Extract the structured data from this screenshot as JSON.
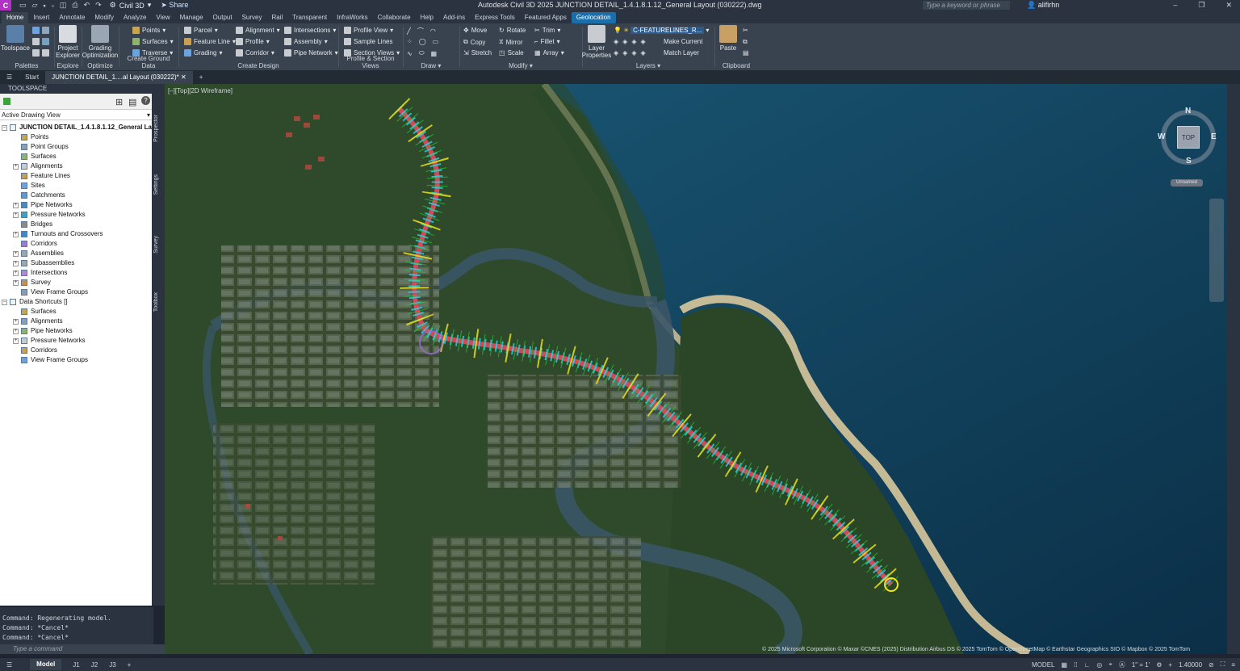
{
  "titlebar": {
    "app_letter": "C",
    "workspace": "Civil 3D",
    "share": "Share",
    "title": "Autodesk Civil 3D 2025   JUNCTION DETAIL_1.4.1.8.1.12_General Layout (030222).dwg",
    "search_placeholder": "Type a keyword or phrase",
    "user": "alifirhn"
  },
  "ribbon_tabs": [
    "Home",
    "Insert",
    "Annotate",
    "Modify",
    "Analyze",
    "View",
    "Manage",
    "Output",
    "Survey",
    "Rail",
    "Transparent",
    "InfraWorks",
    "Collaborate",
    "Help",
    "Add-ins",
    "Express Tools",
    "Featured Apps",
    "Geolocation"
  ],
  "ribbon": {
    "palettes": {
      "title": "Palettes",
      "toolspace": "Toolspace"
    },
    "explore": {
      "title": "Explore",
      "project_explorer": "Project Explorer"
    },
    "optimize": {
      "title": "Optimize",
      "grading_optimization": "Grading Optimization"
    },
    "create_ground": {
      "title": "Create Ground Data",
      "points": "Points",
      "surfaces": "Surfaces",
      "traverse": "Traverse"
    },
    "create_design": {
      "title": "Create Design",
      "parcel": "Parcel",
      "feature_line": "Feature Line",
      "grading": "Grading",
      "alignment": "Alignment",
      "profile": "Profile",
      "corridor": "Corridor",
      "intersections": "Intersections",
      "assembly": "Assembly",
      "pipe_network": "Pipe Network"
    },
    "profile_section": {
      "title": "Profile & Section Views",
      "profile_view": "Profile View",
      "sample_lines": "Sample Lines",
      "section_views": "Section Views"
    },
    "draw": {
      "title": "Draw"
    },
    "modify": {
      "title": "Modify",
      "move": "Move",
      "copy": "Copy",
      "stretch": "Stretch",
      "rotate": "Rotate",
      "mirror": "Mirror",
      "scale": "Scale",
      "trim": "Trim",
      "fillet": "Fillet",
      "array": "Array"
    },
    "layers": {
      "title": "Layers",
      "layer_properties": "Layer Properties",
      "layer_name": "C-FEATURELINES_R...",
      "make_current": "Make Current",
      "match_layer": "Match Layer"
    },
    "clipboard": {
      "title": "Clipboard",
      "paste": "Paste"
    }
  },
  "doc_tabs": {
    "start": "Start",
    "active": "JUNCTION DETAIL_1....al Layout (030222)*"
  },
  "toolspace": {
    "header": "TOOLSPACE",
    "view": "Active Drawing View",
    "root": "JUNCTION DETAIL_1.4.1.8.1.12_General Layou...",
    "items": [
      "Points",
      "Point Groups",
      "Surfaces",
      "Alignments",
      "Feature Lines",
      "Sites",
      "Catchments",
      "Pipe Networks",
      "Pressure Networks",
      "Bridges",
      "Turnouts and Crossovers",
      "Corridors",
      "Assemblies",
      "Subassemblies",
      "Intersections",
      "Survey",
      "View Frame Groups"
    ],
    "shortcuts_root": "Data Shortcuts []",
    "shortcut_items": [
      "Surfaces",
      "Alignments",
      "Pipe Networks",
      "Pressure Networks",
      "Corridors",
      "View Frame Groups"
    ],
    "side_tabs": [
      "Prospector",
      "Settings",
      "Survey",
      "Toolbox"
    ]
  },
  "command_line": {
    "history": [
      "Command:  Regenerating model.",
      "Command: *Cancel*",
      "Command: *Cancel*"
    ],
    "placeholder": "Type a command"
  },
  "viewport": {
    "label": "[–][Top][2D Wireframe]",
    "compass": {
      "n": "N",
      "s": "S",
      "e": "E",
      "w": "W",
      "top": "TOP"
    },
    "wcs": "Unnamed",
    "copyright": "© 2025 Microsoft Corporation © Maxar ©CNES (2025) Distribution Airbus DS © 2025 TomTom © OpenStreetMap © Earthstar Geographics SIO © Mapbox © 2025 TomTom"
  },
  "status": {
    "model": "Model",
    "layouts": [
      "J1",
      "J2",
      "J3"
    ],
    "space": "MODEL",
    "scale": "1\" = 1'",
    "zoom": "1.40000"
  },
  "colors": {
    "road": "#d24a5a",
    "green_marks": "#22c43a",
    "cyan_marks": "#28d4e6",
    "yellow_marks": "#f4e21a",
    "sea": "#0e3a54",
    "land": "#2f4a2a",
    "accent": "#1b6ea8"
  }
}
